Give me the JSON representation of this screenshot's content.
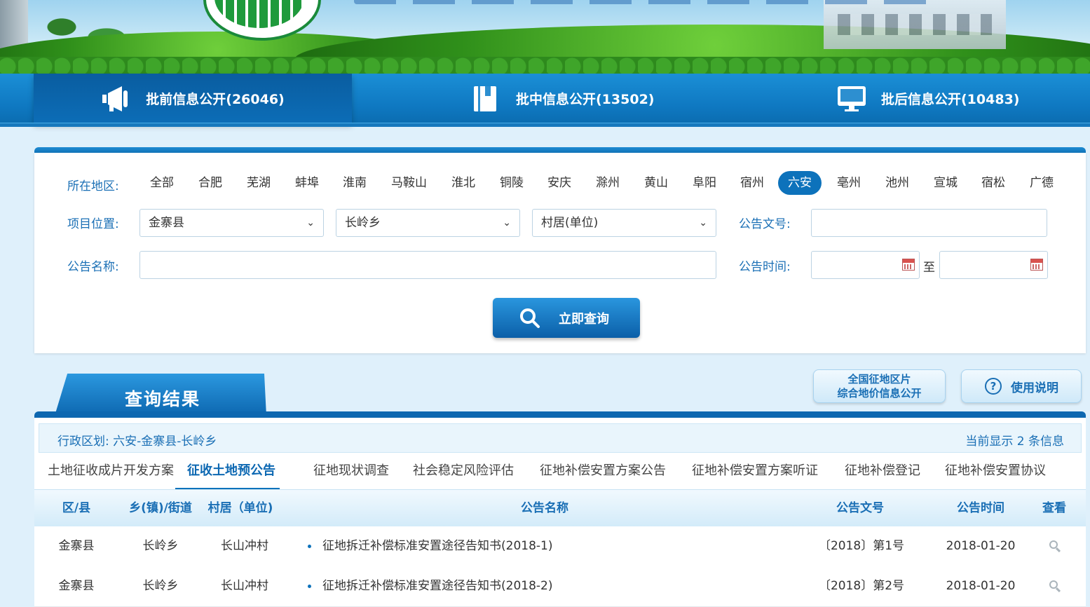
{
  "nav": {
    "tabs": [
      {
        "label": "批前信息公开(26046)",
        "icon": "megaphone-icon",
        "active": true
      },
      {
        "label": "批中信息公开(13502)",
        "icon": "book-icon",
        "active": false
      },
      {
        "label": "批后信息公开(10483)",
        "icon": "monitor-icon",
        "active": false
      }
    ]
  },
  "search": {
    "region_label": "所在地区:",
    "regions": [
      "全部",
      "合肥",
      "芜湖",
      "蚌埠",
      "淮南",
      "马鞍山",
      "淮北",
      "铜陵",
      "安庆",
      "滁州",
      "黄山",
      "阜阳",
      "宿州",
      "六安",
      "亳州",
      "池州",
      "宣城",
      "宿松",
      "广德"
    ],
    "selected_region": "六安",
    "location_label": "项目位置:",
    "county_select": "金寨县",
    "town_select": "长岭乡",
    "village_select": "村居(单位)",
    "doc_no_label": "公告文号:",
    "name_label": "公告名称:",
    "time_label": "公告时间:",
    "time_to": "至",
    "submit_label": "立即查询"
  },
  "results": {
    "title": "查询结果",
    "national_btn_line1": "全国征地区片",
    "national_btn_line2": "综合地价信息公开",
    "help_btn": "使用说明",
    "region_info": "行政区划: 六安-金寨县-长岭乡",
    "count_info": "当前显示 2 条信息",
    "tabs": [
      "土地征收成片开发方案",
      "征收土地预公告",
      "征地现状调查",
      "社会稳定风险评估",
      "征地补偿安置方案公告",
      "征地补偿安置方案听证",
      "征地补偿登记",
      "征地补偿安置协议"
    ],
    "active_tab": "征收土地预公告",
    "columns": [
      "区/县",
      "乡(镇)/街道",
      "村居（单位)",
      "公告名称",
      "公告文号",
      "公告时间",
      "查看"
    ],
    "rows": [
      {
        "county": "金寨县",
        "town": "长岭乡",
        "village": "长山冲村",
        "name": "征地拆迁补偿标准安置途径告知书(2018-1)",
        "doc_no": "〔2018〕第1号",
        "date": "2018-01-20"
      },
      {
        "county": "金寨县",
        "town": "长岭乡",
        "village": "长山冲村",
        "name": "征地拆迁补偿标准安置途径告知书(2018-2)",
        "doc_no": "〔2018〕第2号",
        "date": "2018-01-20"
      }
    ]
  },
  "colors": {
    "primary": "#0d72bb",
    "label": "#1a6fb5",
    "page_bg": "#dff0fb"
  }
}
